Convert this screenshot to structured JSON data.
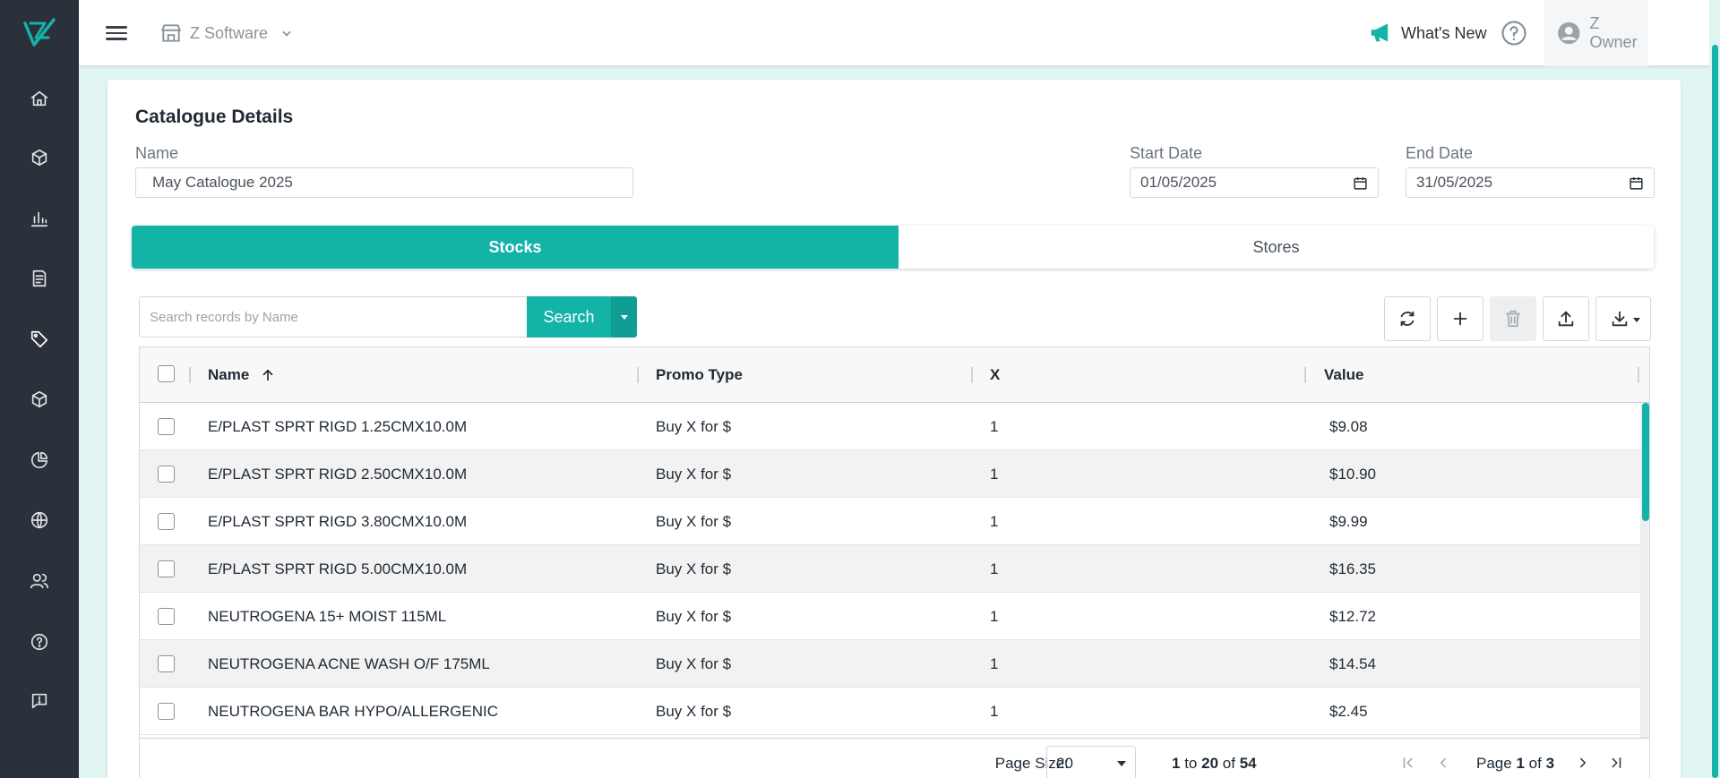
{
  "topbar": {
    "store_name": "Z Software",
    "whats_new": "What's New",
    "user_name": "Z Owner"
  },
  "colors": {
    "accent": "#13b3a8",
    "sidebar": "#2b313a"
  },
  "sidebar": {
    "items": [
      {
        "icon": "home-icon"
      },
      {
        "icon": "package-icon"
      },
      {
        "icon": "bar-chart-icon"
      },
      {
        "icon": "report-icon"
      },
      {
        "icon": "tag-icon"
      },
      {
        "icon": "box-icon"
      },
      {
        "icon": "pie-chart-icon"
      },
      {
        "icon": "globe-icon"
      },
      {
        "icon": "users-icon"
      },
      {
        "icon": "help-icon"
      },
      {
        "icon": "feedback-icon"
      }
    ]
  },
  "card": {
    "title": "Catalogue Details",
    "name_label": "Name",
    "name_value": "May Catalogue 2025",
    "start_label": "Start Date",
    "start_value": "01/05/2025",
    "end_label": "End Date",
    "end_value": "31/05/2025"
  },
  "tabs": [
    {
      "label": "Stocks",
      "active": true
    },
    {
      "label": "Stores",
      "active": false
    }
  ],
  "search": {
    "placeholder": "Search records by Name",
    "button": "Search"
  },
  "grid": {
    "columns": [
      "Name",
      "Promo Type",
      "X",
      "Value"
    ],
    "rows": [
      {
        "name": "E/PLAST SPRT RIGD 1.25CMX10.0M",
        "promo": "Buy X for $",
        "x": "1",
        "value": "$9.08"
      },
      {
        "name": "E/PLAST SPRT RIGD 2.50CMX10.0M",
        "promo": "Buy X for $",
        "x": "1",
        "value": "$10.90"
      },
      {
        "name": "E/PLAST SPRT RIGD 3.80CMX10.0M",
        "promo": "Buy X for $",
        "x": "1",
        "value": "$9.99"
      },
      {
        "name": "E/PLAST SPRT RIGD 5.00CMX10.0M",
        "promo": "Buy X for $",
        "x": "1",
        "value": "$16.35"
      },
      {
        "name": "NEUTROGENA 15+ MOIST 115ML",
        "promo": "Buy X for $",
        "x": "1",
        "value": "$12.72"
      },
      {
        "name": "NEUTROGENA ACNE WASH O/F 175ML",
        "promo": "Buy X for $",
        "x": "1",
        "value": "$14.54"
      },
      {
        "name": "NEUTROGENA BAR HYPO/ALLERGENIC",
        "promo": "Buy X for $",
        "x": "1",
        "value": "$2.45"
      }
    ]
  },
  "pager": {
    "page_size_label": "Page Size:",
    "page_size": "20",
    "from": "1",
    "to_word": "to",
    "to": "20",
    "of_word": "of",
    "total": "54",
    "page_word": "Page",
    "page": "1",
    "page_of": "of",
    "pages": "3"
  }
}
